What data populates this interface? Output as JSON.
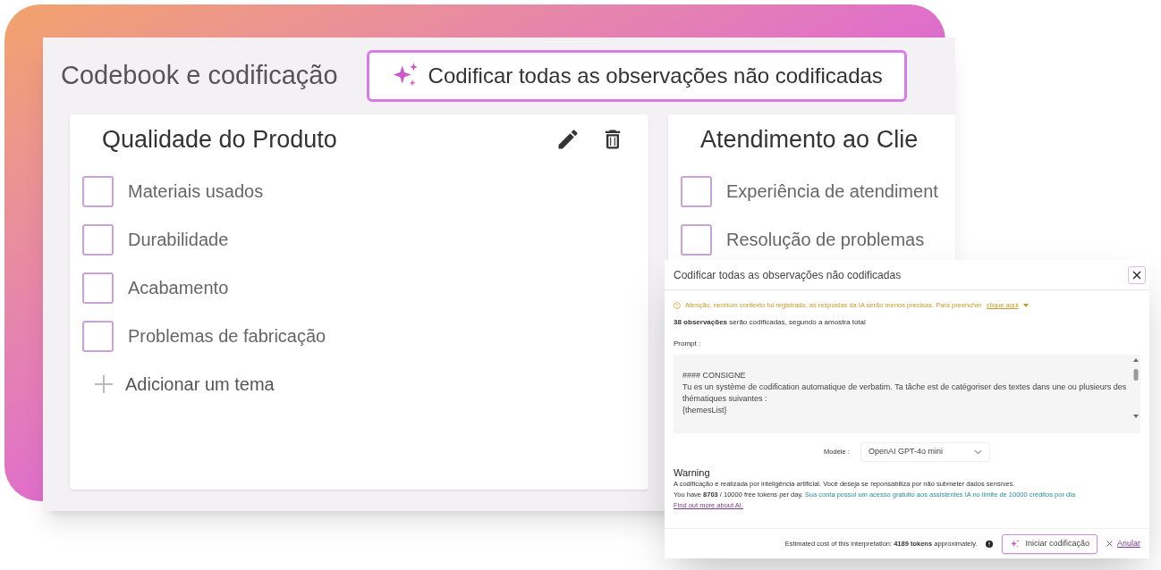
{
  "header": {
    "title": "Codebook e codificação",
    "code_all_button": "Codificar todas as observações não codificadas"
  },
  "themes": [
    {
      "title": "Qualidade do Produto",
      "editable": true,
      "codes": [
        {
          "label": "Materiais usados",
          "checked": false
        },
        {
          "label": "Durabilidade",
          "checked": false
        },
        {
          "label": "Acabamento",
          "checked": false
        },
        {
          "label": "Problemas de fabricação",
          "checked": false
        }
      ],
      "add_label": "Adicionar um tema"
    },
    {
      "title": "Atendimento ao Clie",
      "editable": false,
      "codes": [
        {
          "label": "Experiência de atendiment",
          "checked": false
        },
        {
          "label": "Resolução de problemas",
          "checked": false
        }
      ]
    }
  ],
  "dialog": {
    "title": "Codificar todas as observações não codificadas",
    "warning": "Atenção, nenhum contexto foi registrado, as respostas da IA serão menos precisas. Para preencher",
    "warning_link": "clique aqui",
    "count": "**38 observações** serão codificadas, segundo a amostra total",
    "prompt_label": "Prompt :",
    "prompt": "#### CONSIGNE\nTu es un système de codification automatique de verbatim. Ta tâche est de catégoriser des textes dans une ou plusieurs des thématiques suivantes :\n{themesList}",
    "model_label": "Modèle :",
    "model": "OpenAI GPT-4o mini",
    "warning_title": "Warning",
    "disclaimer": "A codificação é realizada por inteligência artificial. Você deseja se reponsabiliza por não submeter dados sensíves.",
    "tokens": "You have **8703** / 10000 free tokens per day.",
    "credits": "Sua conta possui um acesso gratuito aos assistentes IA no limite de 10000 créditos por dia",
    "learn_link": "Find out more about AI.",
    "estimate": "Estimated cost of this interpretation: **4189 tokens** approximately.",
    "start_button": "Iniciar codificação",
    "cancel_button": "Anular"
  }
}
